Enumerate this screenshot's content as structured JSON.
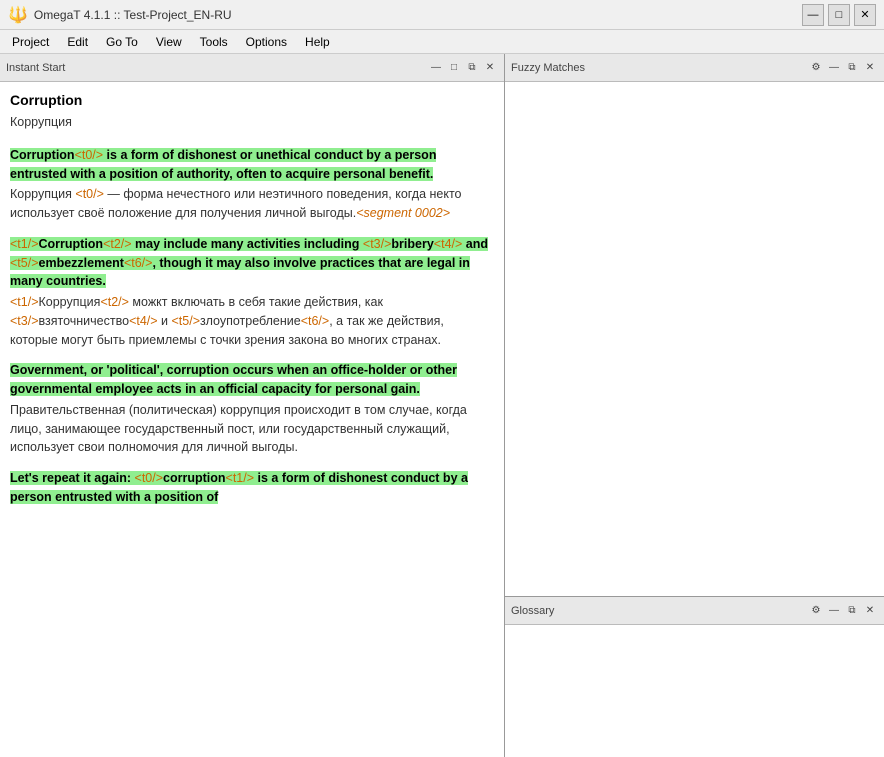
{
  "app": {
    "title": "OmegaT 4.1.1 :: Test-Project_EN-RU",
    "icon": "🔱"
  },
  "title_buttons": {
    "minimize": "—",
    "maximize": "□",
    "close": "✕"
  },
  "menu": {
    "items": [
      "Project",
      "Edit",
      "Go To",
      "View",
      "Tools",
      "Options",
      "Help"
    ]
  },
  "left_panel": {
    "header": "Instant Start",
    "header_buttons": [
      "—",
      "□",
      "⧉",
      "✕"
    ]
  },
  "right_top_panel": {
    "header": "Fuzzy Matches",
    "header_buttons": [
      "⚙",
      "—",
      "⧉",
      "✕"
    ]
  },
  "right_bottom_panel": {
    "header": "Glossary",
    "header_buttons": [
      "⚙",
      "—",
      "⧉",
      "✕"
    ]
  },
  "content": {
    "segment0_src_title": "Corruption",
    "segment0_tgt_title": "Коррупция",
    "segment1_parts": {
      "before_tag": "Corruption",
      "tag1": "<t0/>",
      "main": " is a form of dishonest or unethical conduct by a person entrusted with a position of authority, often to acquire personal benefit.",
      "tgt_before": "Коррупция ",
      "tgt_tag": "<t0/>",
      "tgt_after": " — форма нечестного или неэтичного поведения, когда некто использует своё положение для получения личной выгоды.",
      "tgt_marker": "<segment 0002>"
    },
    "segment2_parts": {
      "tag1": "<t1/>",
      "word1": "Corruption",
      "tag2": "<t2/>",
      "mid1": " may include many activities including ",
      "tag3": "<t3/>",
      "word2": "bribery",
      "tag4": "<t4/>",
      "mid2": " and ",
      "tag5": "<t5/>",
      "word3": "embezzlement",
      "tag6": "<t6/>",
      "end1": ", though it may also involve practices that are legal in many countries.",
      "tgt_tag1": "<t1/>",
      "tgt_word1": "Коррупция",
      "tgt_tag2": "<t2/>",
      "tgt_mid1": " можкт включать в себя такие действия, как ",
      "tgt_tag3": "<t3/>",
      "tgt_word2": "взяточничество",
      "tgt_tag4": "<t4/>",
      "tgt_and": " и ",
      "tgt_tag5": "<t5/>",
      "tgt_word3": "злоупотребление",
      "tgt_tag6": "<t6/>",
      "tgt_end": ", а так же действия, которые могут быть приемлемы с точки зрения закона во многих странах."
    },
    "segment3_parts": {
      "main": "Government, or 'political', corruption occurs when an office-holder or other governmental employee acts in an official capacity for personal gain.",
      "tgt": "Правительственная (политическая) коррупция происходит в том случае, когда лицо, занимающее государственный пост, или государственный служащий, использует свои полномочия для личной выгоды."
    },
    "segment4_parts": {
      "intro": "Let's repeat it again: ",
      "tag1": "<t0/>",
      "word1": "corruption",
      "tag2": "<t1/>",
      "end": " is a form of dishonest conduct by a person entrusted with a position of"
    }
  }
}
